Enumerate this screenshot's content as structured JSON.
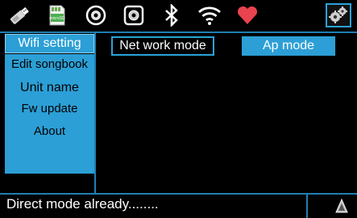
{
  "topbar": {
    "icons": [
      "pen-drive-icon",
      "sd-card-icon",
      "disc-icon",
      "speaker-icon",
      "bluetooth-icon",
      "wifi-icon",
      "heart-icon",
      "settings-gears-icon"
    ],
    "sd_label": "microSD"
  },
  "sidebar": {
    "items": [
      {
        "label": "Wifi setting",
        "active": true
      },
      {
        "label": "Edit songbook"
      },
      {
        "label": "Unit name"
      },
      {
        "label": "Fw update"
      },
      {
        "label": "About"
      }
    ]
  },
  "main": {
    "tabs": [
      {
        "label": "Net work mode"
      },
      {
        "label": "Ap mode"
      }
    ]
  },
  "status": {
    "text": "Direct mode already........"
  },
  "colors": {
    "accent": "#2c9fd6",
    "border": "#1f7fb3",
    "background": "#000000",
    "heart": "#e8434f"
  }
}
